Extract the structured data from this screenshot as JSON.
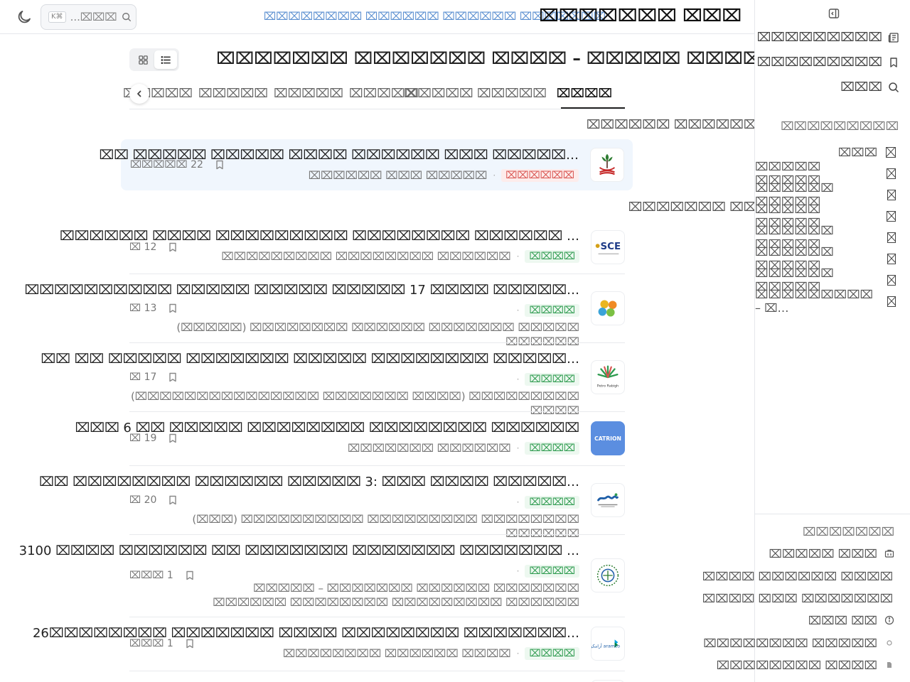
{
  "header": {
    "site_title": "⌧⌧⌧⌧⌧⌧⌧ ⌧⌧⌧",
    "breadcrumb": "⌧⌧⌧⌧⌧⌧⌧⌧ ⌧⌧⌧⌧⌧⌧ ⌧⌧⌧⌧⌧⌧ ⌧⌧⌧⌧⌧⌧⌧",
    "search_placeholder": "...⌧⌧⌧",
    "search_shortcut": "K⌘"
  },
  "main": {
    "page_title": "⌧⌧⌧⌧⌧⌧⌧ ⌧⌧⌧⌧⌧⌧⌧ ⌧⌧⌧⌧ – ⌧⌧⌧⌧⌧ ⌧⌧⌧⌧⌧",
    "tabs": [
      "⌧⌧⌧⌧",
      "⌧⌧⌧⌧⌧ ⌧⌧⌧⌧⌧",
      "⌧⌧⌧⌧⌧",
      "⌧⌧⌧⌧⌧",
      "⌧⌧⌧⌧⌧",
      "⌧⌧⌧⌧⌧"
    ],
    "pinned_group_title": "⌧⌧⌧⌧⌧⌧ ⌧⌧⌧⌧⌧⌧⌧",
    "pinned": {
      "title": "⌧⌧ ⌧⌧⌧⌧⌧ ⌧⌧⌧⌧⌧ ⌧⌧⌧⌧ ⌧⌧⌧⌧⌧⌧ ⌧⌧⌧ ⌧⌧⌧⌧⌧…",
      "badge": "⌧⌧⌧⌧⌧⌧",
      "org": "⌧⌧⌧⌧⌧⌧ ⌧⌧⌧ ⌧⌧⌧⌧⌧",
      "date": "⌧⌧⌧⌧⌧ 22"
    },
    "latest_group_title": "⌧⌧⌧⌧⌧⌧⌧ ⌧⌧⌧",
    "items": [
      {
        "title": "⌧⌧⌧⌧⌧⌧ ⌧⌧⌧⌧ ⌧⌧⌧⌧⌧⌧⌧⌧⌧ ⌧⌧⌧⌧⌧⌧⌧⌧ ⌧⌧⌧⌧⌧⌧ …",
        "badge": "⌧⌧⌧⌧",
        "org": "⌧⌧⌧⌧⌧⌧⌧⌧⌧ ⌧⌧⌧⌧⌧⌧⌧⌧ ⌧⌧⌧⌧⌧⌧",
        "org2": "",
        "date": "⌧ 12"
      },
      {
        "title": "⌧⌧⌧⌧⌧⌧⌧⌧⌧⌧ ⌧⌧⌧⌧⌧ ⌧⌧⌧⌧⌧ ⌧⌧⌧⌧⌧ 17 ⌧⌧⌧⌧ ⌧⌧⌧⌧⌧…",
        "badge": "⌧⌧⌧⌧",
        "org": "",
        "org2": "(⌧⌧⌧⌧⌧) ⌧⌧⌧⌧⌧⌧⌧⌧ ⌧⌧⌧⌧⌧⌧ ⌧⌧⌧⌧⌧⌧⌧ ⌧⌧⌧⌧⌧ ⌧⌧⌧⌧⌧⌧",
        "date": "⌧ 13"
      },
      {
        "title": "⌧⌧ ⌧⌧ ⌧⌧⌧⌧⌧ ⌧⌧⌧⌧⌧⌧⌧ ⌧⌧⌧⌧⌧ ⌧⌧⌧⌧⌧⌧⌧⌧ ⌧⌧⌧⌧⌧…",
        "badge": "⌧⌧⌧⌧",
        "org": "",
        "org2": "(⌧⌧⌧⌧⌧⌧⌧⌧⌧⌧⌧⌧⌧⌧⌧ ⌧⌧⌧⌧⌧⌧⌧ ⌧⌧⌧⌧) ⌧⌧⌧⌧⌧⌧⌧⌧⌧ ⌧⌧⌧⌧",
        "date": "⌧ 17"
      },
      {
        "title": "⌧⌧⌧ 6 ⌧⌧ ⌧⌧⌧⌧⌧ ⌧⌧⌧⌧⌧⌧⌧⌧ ⌧⌧⌧⌧⌧⌧⌧⌧ ⌧⌧⌧⌧⌧⌧",
        "badge": "⌧⌧⌧⌧",
        "org": "⌧⌧⌧⌧⌧⌧⌧ ⌧⌧⌧⌧⌧⌧",
        "org2": "",
        "date": "⌧ 19"
      },
      {
        "title": "⌧⌧ ⌧⌧⌧⌧⌧⌧⌧⌧ ⌧⌧⌧⌧⌧⌧ ⌧⌧⌧⌧⌧ 3: ⌧⌧⌧ ⌧⌧⌧⌧ ⌧⌧⌧⌧⌧…",
        "badge": "⌧⌧⌧⌧",
        "org": "",
        "org2": "(⌧⌧⌧) ⌧⌧⌧⌧⌧⌧⌧⌧⌧⌧ ⌧⌧⌧⌧⌧⌧⌧⌧⌧ ⌧⌧⌧⌧⌧⌧⌧⌧ ⌧⌧⌧⌧⌧⌧",
        "date": "⌧ 20"
      },
      {
        "title": "3100 ⌧⌧⌧⌧ ⌧⌧⌧⌧⌧⌧ ⌧⌧ ⌧⌧⌧⌧⌧⌧⌧ ⌧⌧⌧⌧⌧⌧⌧ ⌧⌧⌧⌧⌧⌧⌧ …",
        "badge": "⌧⌧⌧⌧",
        "org": "",
        "org2": "⌧⌧⌧⌧⌧ – ⌧⌧⌧⌧⌧⌧⌧ ⌧⌧⌧⌧⌧⌧ ⌧⌧⌧⌧⌧⌧⌧ ⌧⌧⌧⌧⌧⌧ ⌧⌧⌧⌧⌧⌧⌧⌧ ⌧⌧⌧⌧⌧⌧⌧⌧⌧ ⌧⌧⌧⌧⌧⌧",
        "date": "⌧⌧⌧ 1"
      },
      {
        "title": "26⌧⌧⌧⌧⌧⌧⌧⌧ ⌧⌧⌧⌧⌧⌧⌧ ⌧⌧⌧⌧ ⌧⌧⌧⌧⌧⌧⌧⌧ ⌧⌧⌧⌧⌧⌧⌧…",
        "badge": "⌧⌧⌧⌧",
        "org": "⌧⌧⌧⌧⌧⌧⌧⌧ ⌧⌧⌧⌧⌧⌧ ⌧⌧⌧⌧",
        "org2": "",
        "date": "⌧⌧⌧ 1"
      }
    ],
    "logos": [
      "SCE",
      "CATRION",
      "Petro Rabigh",
      "أرامكو aramco"
    ]
  },
  "sidebar": {
    "nav": [
      {
        "label": "⌧⌧⌧⌧⌧⌧⌧⌧⌧",
        "icon": "newspaper-icon"
      },
      {
        "label": "⌧⌧⌧⌧⌧⌧⌧⌧⌧",
        "icon": "bookmark-icon"
      },
      {
        "label": "⌧⌧⌧",
        "icon": "search-icon"
      }
    ],
    "categories_title": "⌧⌧⌧⌧⌧⌧⌧⌧⌧",
    "categories": [
      "⌧⌧⌧",
      "⌧⌧⌧⌧⌧ ⌧⌧⌧⌧⌧",
      "⌧⌧⌧⌧⌧⌧ ⌧⌧⌧⌧⌧",
      "⌧⌧⌧⌧⌧ ⌧⌧⌧⌧⌧",
      "⌧⌧⌧⌧⌧⌧ ⌧⌧⌧⌧⌧",
      "⌧⌧⌧⌧⌧⌧ ⌧⌧⌧⌧⌧",
      "⌧⌧⌧⌧⌧⌧ ⌧⌧⌧⌧⌧",
      "⌧⌧⌧⌧⌧⌧⌧⌧⌧ – ⌧…"
    ],
    "footer_title": "⌧⌧⌧⌧⌧⌧⌧",
    "footer": [
      {
        "label": "⌧⌧⌧⌧⌧ ⌧⌧⌧",
        "icon": "briefcase-icon"
      },
      {
        "label": "⌧⌧⌧⌧ ⌧⌧⌧⌧⌧⌧ ⌧⌧⌧⌧",
        "icon": ""
      },
      {
        "label": "⌧⌧⌧⌧ ⌧⌧⌧ ⌧⌧⌧⌧⌧⌧⌧",
        "icon": ""
      },
      {
        "label": "⌧⌧⌧ ⌧⌧",
        "icon": "info-icon"
      },
      {
        "label": "⌧⌧⌧⌧⌧⌧⌧⌧ ⌧⌧⌧⌧⌧",
        "icon": "circle-icon"
      },
      {
        "label": "⌧⌧⌧⌧⌧⌧⌧⌧ ⌧⌧⌧⌧",
        "icon": "document-icon"
      }
    ]
  },
  "colors": {
    "accent_blue": "#5b8fd0",
    "badge_green": "#2e9b4f",
    "badge_red": "#d9534f",
    "pinned_bg": "#f0f6fd",
    "catrion_blue": "#5b8ee0"
  }
}
